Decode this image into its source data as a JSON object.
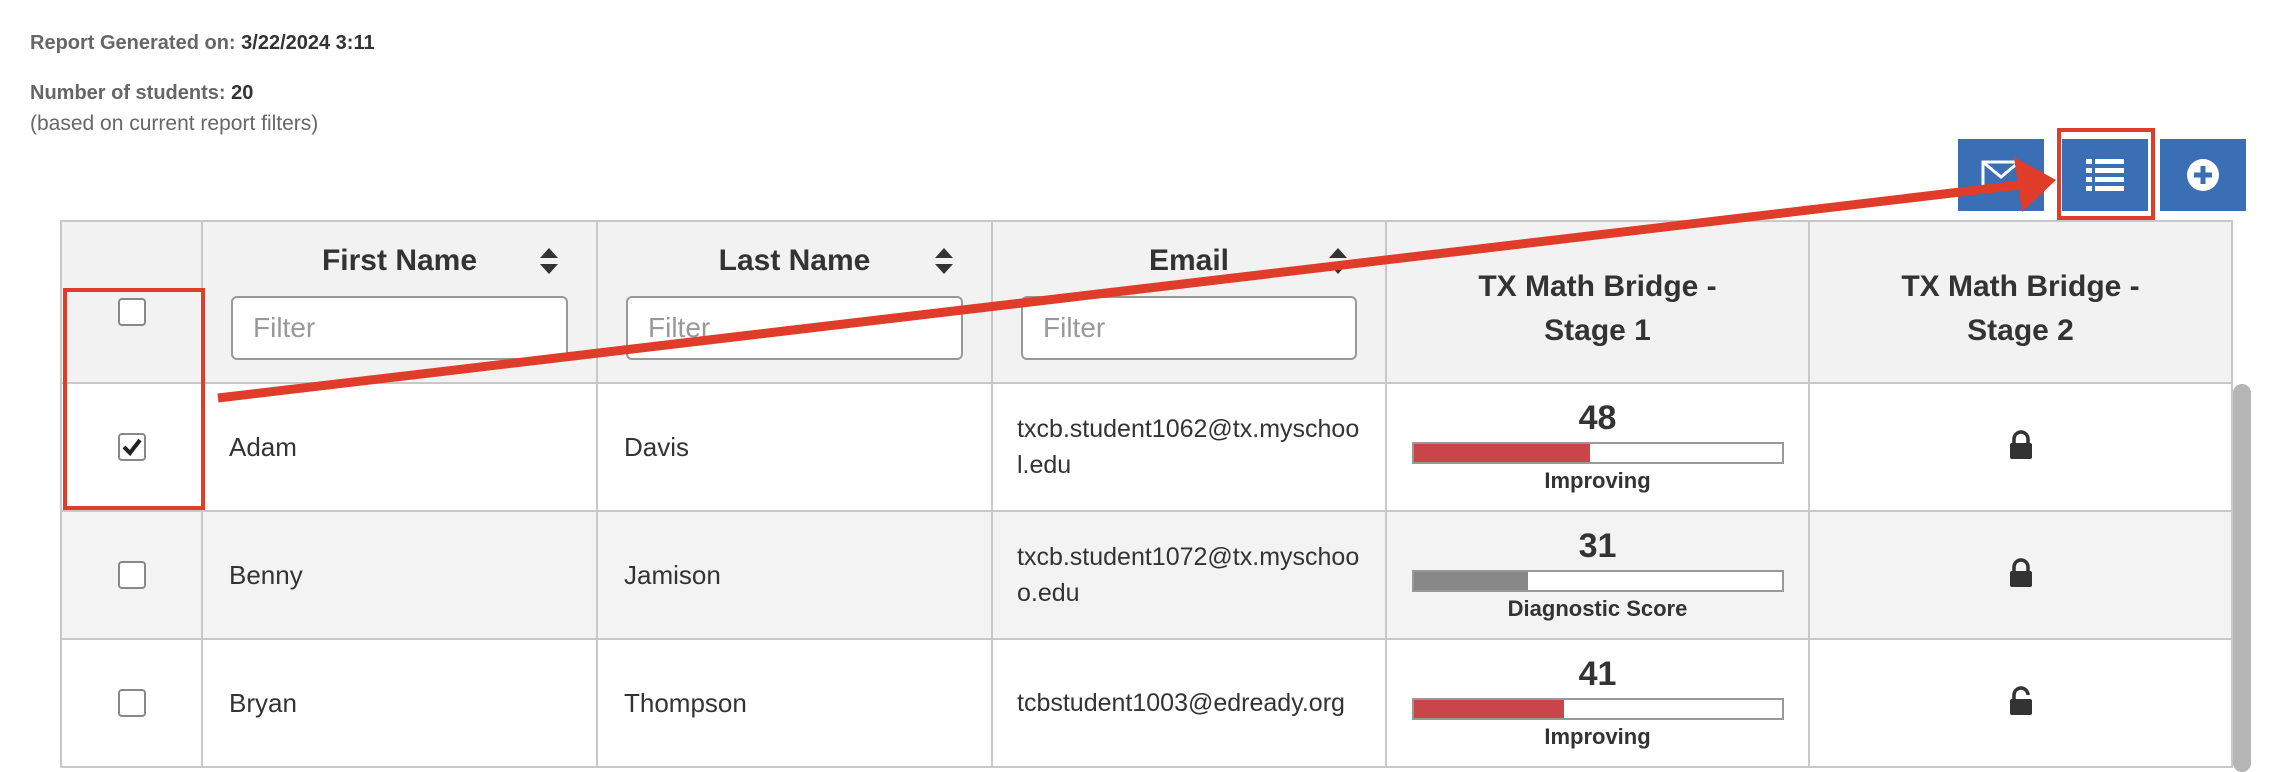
{
  "report": {
    "generated_label": "Report Generated on:",
    "generated_value": "3/22/2024 3:11",
    "students_label": "Number of students:",
    "students_value": "20",
    "filter_note": "(based on current report filters)"
  },
  "toolbar": {
    "email_icon": "envelope-icon",
    "list_icon": "list-icon",
    "add_icon": "plus-circle-icon"
  },
  "table": {
    "headers": {
      "first_name": "First Name",
      "last_name": "Last Name",
      "email": "Email",
      "stage1": "TX Math Bridge - Stage 1",
      "stage2": "TX Math Bridge - Stage 2"
    },
    "filter_placeholder": "Filter",
    "rows": [
      {
        "checked": true,
        "first": "Adam",
        "last": "Davis",
        "email": "txcb.student1062@tx.myschool.edu",
        "score": "48",
        "score_fraction": 0.48,
        "bar_color": "#c9454a",
        "status": "Improving",
        "stage2": "locked"
      },
      {
        "checked": false,
        "first": "Benny",
        "last": "Jamison",
        "email": "txcb.student1072@tx.myschooo.edu",
        "score": "31",
        "score_fraction": 0.31,
        "bar_color": "#888888",
        "status": "Diagnostic Score",
        "stage2": "locked"
      },
      {
        "checked": false,
        "first": "Bryan",
        "last": "Thompson",
        "email": "tcbstudent1003@edready.org",
        "score": "41",
        "score_fraction": 0.41,
        "bar_color": "#c9454a",
        "status": "Improving",
        "stage2": "unlocked"
      }
    ]
  },
  "colors": {
    "button_blue": "#3a6eb5",
    "annotation_red": "#e03c2a",
    "improving_red": "#c9454a",
    "diagnostic_gray": "#888888"
  }
}
